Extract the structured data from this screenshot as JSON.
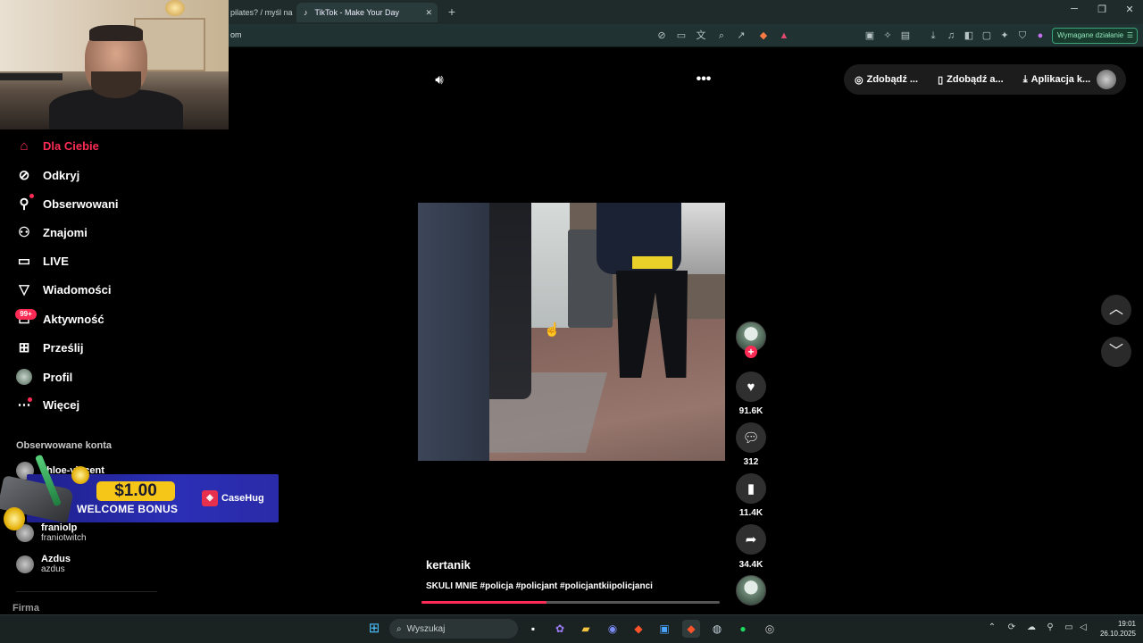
{
  "browser": {
    "tabs": [
      {
        "label": "pilates? / myśl na"
      },
      {
        "label": "TikTok - Make Your Day"
      }
    ],
    "address": "om",
    "wymagane_label": "Wymagane działanie"
  },
  "sidebar": {
    "items": [
      {
        "label": "Dla Ciebie",
        "icon": "home-icon"
      },
      {
        "label": "Odkryj",
        "icon": "compass-icon"
      },
      {
        "label": "Obserwowani",
        "icon": "following-icon"
      },
      {
        "label": "Znajomi",
        "icon": "friends-icon"
      },
      {
        "label": "LIVE",
        "icon": "live-icon"
      },
      {
        "label": "Wiadomości",
        "icon": "messages-icon"
      },
      {
        "label": "Aktywność",
        "icon": "activity-icon"
      },
      {
        "label": "Prześlij",
        "icon": "upload-icon"
      },
      {
        "label": "Profil",
        "icon": "profile-avatar"
      },
      {
        "label": "Więcej",
        "icon": "more-icon"
      }
    ],
    "activity_badge": "99+",
    "followed_title": "Obserwowane konta",
    "accounts": [
      {
        "name": "chloe-vincent",
        "handle": ""
      },
      {
        "name": "franiolp",
        "handle": "franiotwitch"
      },
      {
        "name": "Azdus",
        "handle": "azdus"
      }
    ],
    "footer_label": "Firma"
  },
  "ad": {
    "price": "$1.00",
    "bonus": "WELCOME BONUS",
    "brand": "CaseHug"
  },
  "video": {
    "author": "kertanik",
    "caption": "SKULI MNIE #policja #policjant #policjantkiipolicjanci",
    "progress": 0.42,
    "likes": "91.6K",
    "comments": "312",
    "saves": "11.4K",
    "shares": "34.4K"
  },
  "top_actions": [
    {
      "label": "Zdobądź ...",
      "icon": "coin-icon"
    },
    {
      "label": "Zdobądź a...",
      "icon": "phone-icon"
    },
    {
      "label": "Aplikacja k...",
      "icon": "download-icon"
    }
  ],
  "taskbar": {
    "search_placeholder": "Wyszukaj",
    "time": "19:01",
    "date": "26.10.2025"
  },
  "colors": {
    "accent": "#fe2c55",
    "background": "#000000",
    "taskbar": "#1a2222"
  }
}
